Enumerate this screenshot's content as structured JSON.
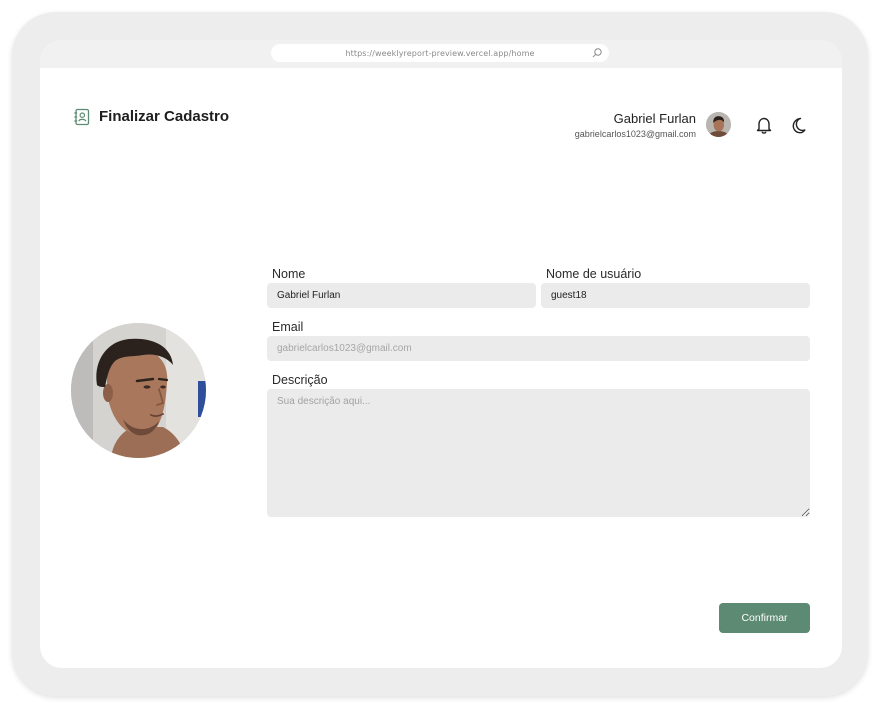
{
  "browser": {
    "url": "https://weeklyreport-preview.vercel.app/home"
  },
  "header": {
    "title": "Finalizar Cadastro",
    "icon": "contact-book-icon"
  },
  "user": {
    "name": "Gabriel Furlan",
    "email": "gabrielcarlos1023@gmail.com"
  },
  "form": {
    "name_label": "Nome",
    "name_value": "Gabriel Furlan",
    "username_label": "Nome de usuário",
    "username_value": "guest18",
    "email_label": "Email",
    "email_value": "gabrielcarlos1023@gmail.com",
    "description_label": "Descrição",
    "description_placeholder": "Sua descrição aqui...",
    "confirm_label": "Confirmar"
  },
  "colors": {
    "accent": "#5d8a72",
    "field_bg": "#ebebeb",
    "device_frame": "#ededed"
  }
}
